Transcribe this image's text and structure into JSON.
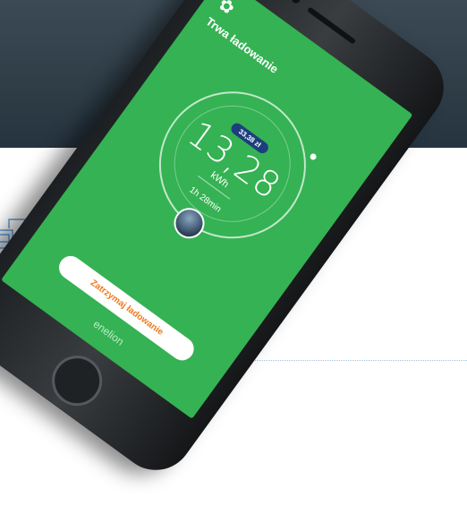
{
  "app": {
    "title": "Trwa ładowanie",
    "subtitle": "",
    "price_label": "",
    "price_value": "33,38 zł",
    "energy_value": "13,28",
    "energy_unit": "kWh",
    "duration_label": "",
    "duration_value": "1h 28min",
    "note": "",
    "stop_button": "Zatrzymaj ładowanie",
    "brand": "enelion",
    "logo_icon": "flower-logo-icon"
  },
  "colors": {
    "screen": "#35b253",
    "pill": "#1d3e7c",
    "button_text": "#ef7a1a",
    "banner": "#2f3d47"
  }
}
